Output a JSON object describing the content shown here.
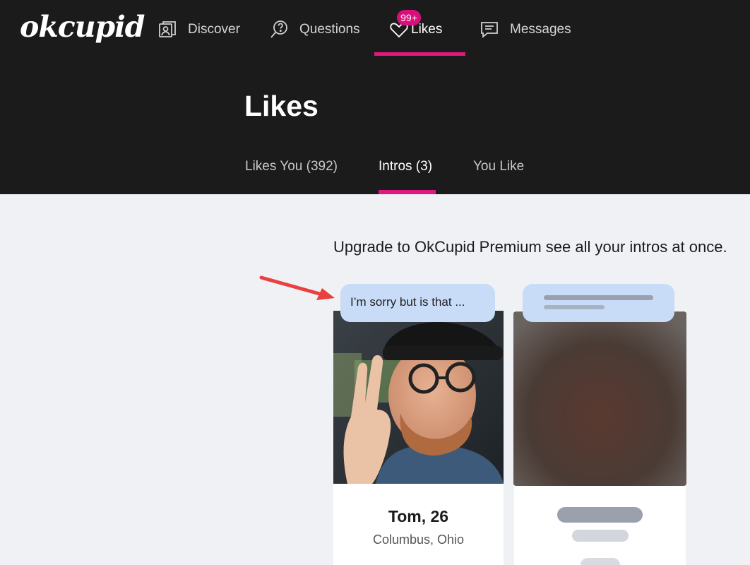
{
  "brand": {
    "logo": "okcupid"
  },
  "nav": {
    "items": [
      {
        "label": "Discover",
        "icon": "discover-photos-icon"
      },
      {
        "label": "Questions",
        "icon": "question-bubble-icon"
      },
      {
        "label": "Likes",
        "icon": "heart-tag-icon",
        "badge": "99+"
      },
      {
        "label": "Messages",
        "icon": "message-bubble-icon"
      }
    ],
    "active": "Likes"
  },
  "page": {
    "title": "Likes"
  },
  "tabs": [
    {
      "label": "Likes You (392)"
    },
    {
      "label": "Intros (3)"
    },
    {
      "label": "You Like"
    }
  ],
  "active_tab": "Intros (3)",
  "upgrade_text": "Upgrade to OkCupid Premium see all your intros at once.",
  "cards": [
    {
      "message": "I’m sorry but is that ...",
      "name": "Tom, 26",
      "location": "Columbus, Ohio",
      "blurred": false
    },
    {
      "blurred": true
    }
  ],
  "colors": {
    "accent": "#e0197e",
    "header_bg": "#1b1b1c",
    "page_bg": "#f0f1f5",
    "bubble": "#c9dcf7",
    "annotation_arrow": "#e8413f"
  }
}
